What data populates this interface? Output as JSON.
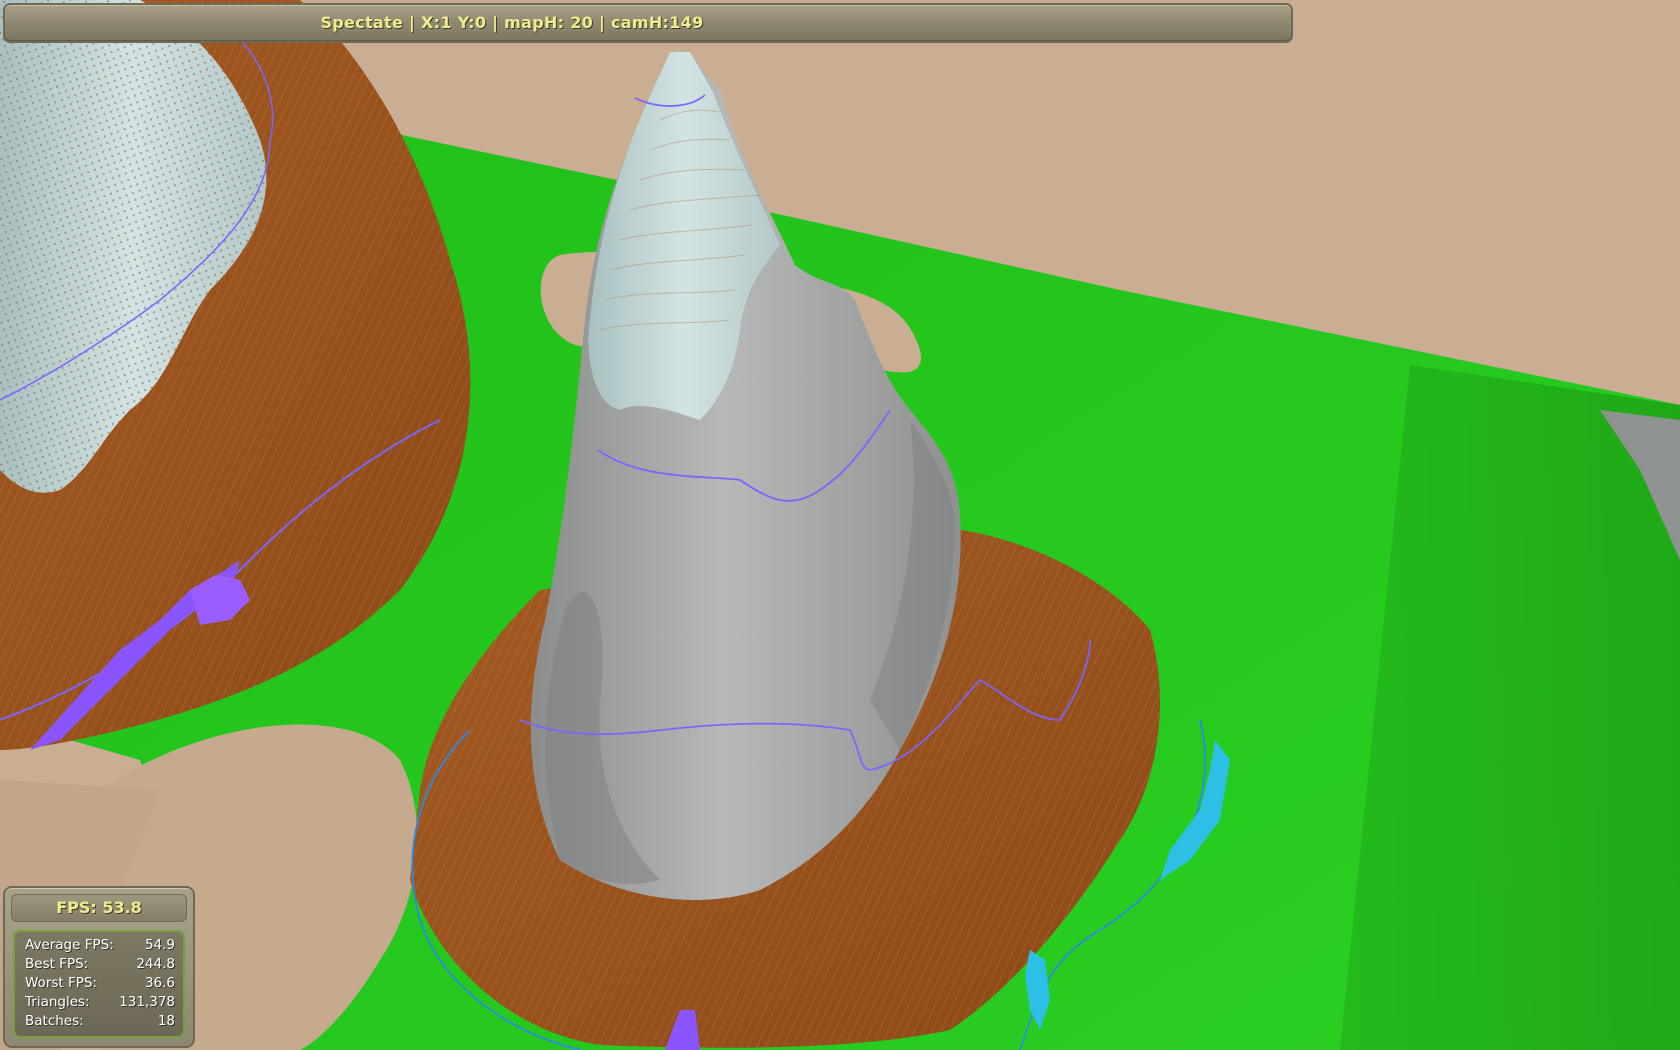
{
  "status_bar": {
    "text": "Spectate | X:1 Y:0 | mapH:  20 | camH:149"
  },
  "fps_panel": {
    "title": "FPS: 53.8",
    "stats": [
      {
        "label": "Average FPS:",
        "value": "54.9"
      },
      {
        "label": "Best FPS:",
        "value": "244.8"
      },
      {
        "label": "Worst FPS:",
        "value": "36.6"
      },
      {
        "label": "Triangles:",
        "value": "131,378"
      },
      {
        "label": "Batches:",
        "value": "18"
      }
    ]
  },
  "colors": {
    "sky": "#c9ae94",
    "grass": "#22c51c",
    "rock": "#a7a9a8",
    "dirt": "#9b5420",
    "snow": "#c6dada",
    "water": "#2cc0e6",
    "contour": "#7a66ff",
    "hud_text": "#f0eb8c"
  }
}
